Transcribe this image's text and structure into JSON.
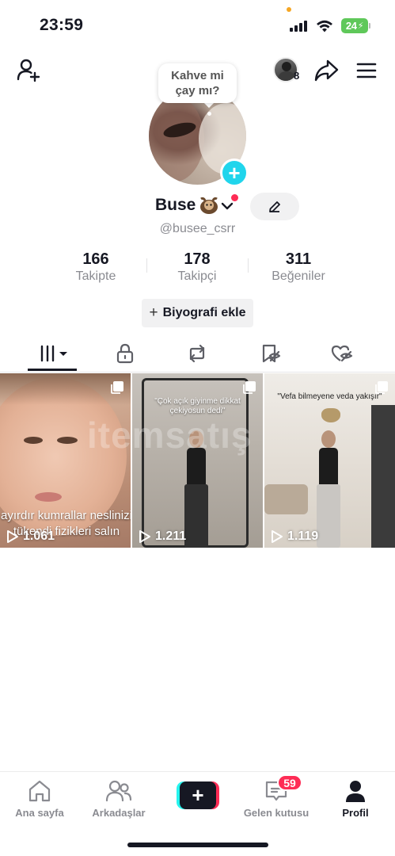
{
  "status_bar": {
    "time": "23:59",
    "battery": "24"
  },
  "profile": {
    "story_count": "8",
    "note_bubble": "Kahve mi\nçay mı?",
    "note_line1": "Kahve mi",
    "note_line2": "çay mı?",
    "name": "Buse",
    "username": "@busee_csrr",
    "stats": [
      {
        "value": "166",
        "label": "Takipte"
      },
      {
        "value": "178",
        "label": "Takipçi"
      },
      {
        "value": "311",
        "label": "Beğeniler"
      }
    ],
    "bio_button": "Biyografi ekle"
  },
  "tabs": [
    {
      "icon": "grid-icon",
      "active": true
    },
    {
      "icon": "lock-icon",
      "active": false
    },
    {
      "icon": "repost-icon",
      "active": false
    },
    {
      "icon": "saved-hidden-icon",
      "active": false
    },
    {
      "icon": "liked-hidden-icon",
      "active": false
    }
  ],
  "videos": [
    {
      "caption_line1": "ayırdır kumrallar neslinizi",
      "caption_line2": "tükendi fizikleri salın",
      "views": "1.061"
    },
    {
      "caption_line1": "\"Çok açık giyinme dikkat",
      "caption_line2": "çekiyosun dedi\"",
      "views": "1.211"
    },
    {
      "caption_line1": "\"Vefa bilmeyene veda yakışır\"",
      "caption_line2": "",
      "views": "1.119"
    }
  ],
  "watermark": "itemsatış",
  "bottom_nav": {
    "items": [
      {
        "label": "Ana sayfa"
      },
      {
        "label": "Arkadaşlar"
      },
      {
        "label": "Gelen kutusu",
        "badge": "59"
      },
      {
        "label": "Profil"
      }
    ]
  },
  "colors": {
    "accent": "#fe2c55",
    "story_blue": "#20d5ec",
    "battery_green": "#5fc85a"
  }
}
